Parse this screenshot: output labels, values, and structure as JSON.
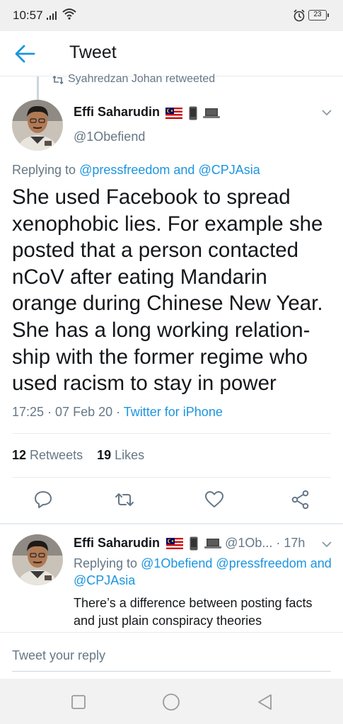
{
  "status_bar": {
    "time": "10:57",
    "battery": "23"
  },
  "header": {
    "title": "Tweet"
  },
  "retweet": {
    "text": "Syahredzan Johan retweeted"
  },
  "tweet": {
    "author_name": "Effi Saharudin",
    "author_handle": "@1Obefiend",
    "replying_prefix": "Replying to ",
    "replying_mention_1": "@pressfreedom",
    "replying_and": " and ",
    "replying_mention_2": "@CPJAsia",
    "text": "She used Facebook to spread xenophobic lies. For example she posted that a person contacted nCoV after eating Mandarin orange during Chinese New Year. She has a long working relation-ship with the former regime who used racism to stay in power",
    "time": "17:25",
    "date": "07 Feb 20",
    "source": "Twitter for iPhone",
    "retweets_count": "12",
    "retweets_label": "Retweets",
    "likes_count": "19",
    "likes_label": "Likes"
  },
  "reply": {
    "author_name": "Effi Saharudin",
    "author_handle": "@1Ob...",
    "age": "17h",
    "replying_prefix": "Replying to ",
    "replying_mention_1": "@1Obefiend",
    "replying_mention_2": "@pressfreedom",
    "replying_and": "and ",
    "replying_mention_3": "@CPJAsia",
    "text": "There’s a difference between posting facts and just plain conspiracy theories"
  },
  "compose": {
    "placeholder": "Tweet your reply"
  },
  "colors": {
    "accent": "#1b95e0",
    "secondary_text": "#657786",
    "primary_text": "#14171a"
  },
  "icons": {
    "back": "arrow-left-icon",
    "reply": "reply-icon",
    "retweet": "retweet-icon",
    "like": "heart-icon",
    "share": "share-icon"
  }
}
